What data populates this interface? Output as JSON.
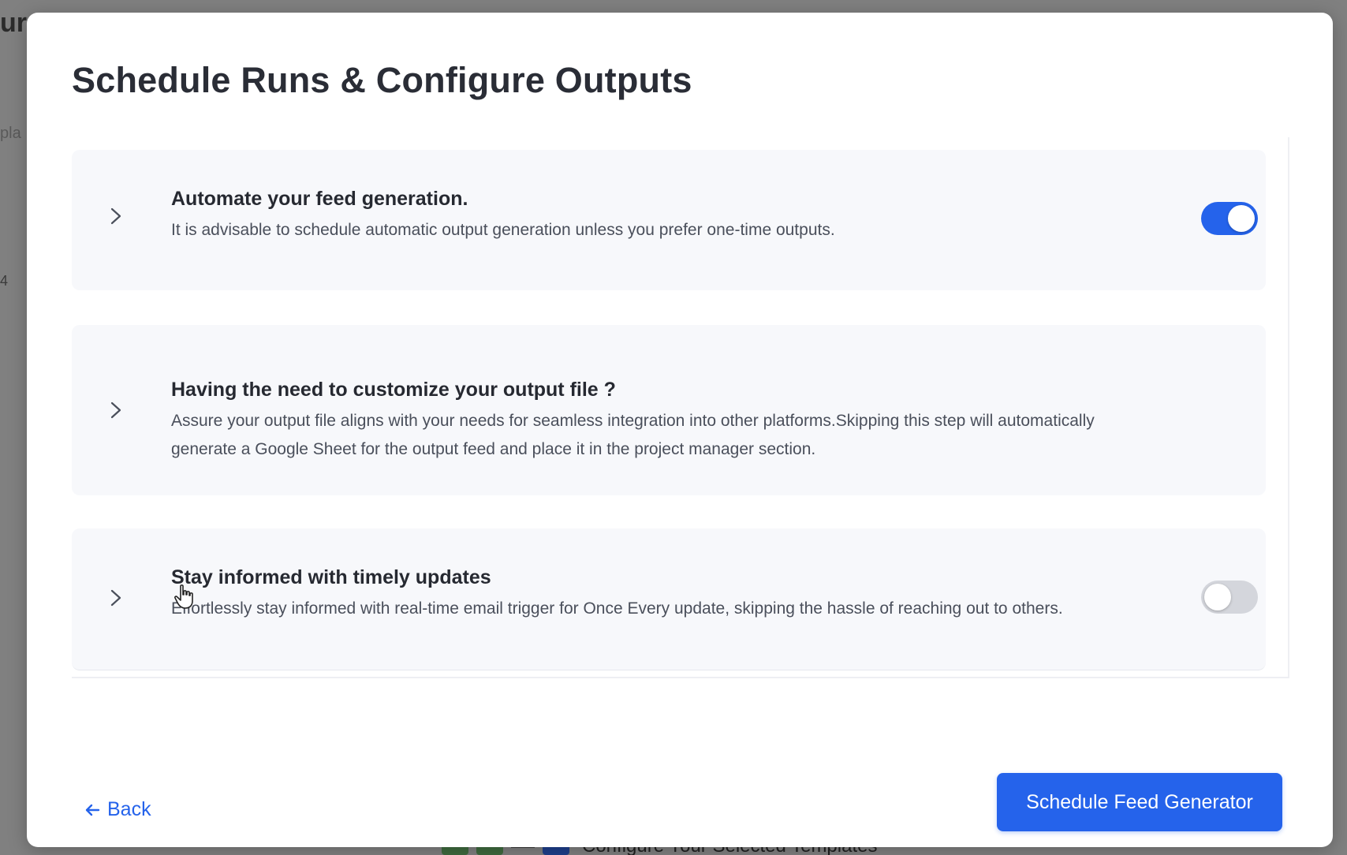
{
  "background": {
    "fragment_1": "ur",
    "fragment_2": "pla",
    "fragment_3": "4",
    "footer_text": "Configure Your Selected Templates"
  },
  "modal": {
    "title": "Schedule Runs & Configure Outputs",
    "sections": [
      {
        "title": "Automate your feed generation.",
        "description": "It is advisable to schedule automatic output generation unless you prefer one-time outputs.",
        "toggle_on": true
      },
      {
        "title": "Having the need to customize your output file ?",
        "description": "Assure your output file aligns with your needs for seamless integration into other platforms.Skipping this step will automatically generate a Google Sheet for the output feed and place it in the project manager section."
      },
      {
        "title": "Stay informed with timely updates",
        "description": "Effortlessly stay informed with real-time email trigger for Once Every update, skipping the hassle of reaching out to others.",
        "toggle_on": false
      }
    ],
    "back_label": "Back",
    "primary_button_label": "Schedule Feed Generator"
  },
  "colors": {
    "accent": "#2563eb",
    "card_bg": "#f7f8fb",
    "title_text": "#2a2d36",
    "toggle_off": "#d4d6dc"
  },
  "icons": {
    "expand": "chevron-right-icon",
    "back": "arrow-left-icon",
    "pointer": "hand-cursor-icon"
  }
}
